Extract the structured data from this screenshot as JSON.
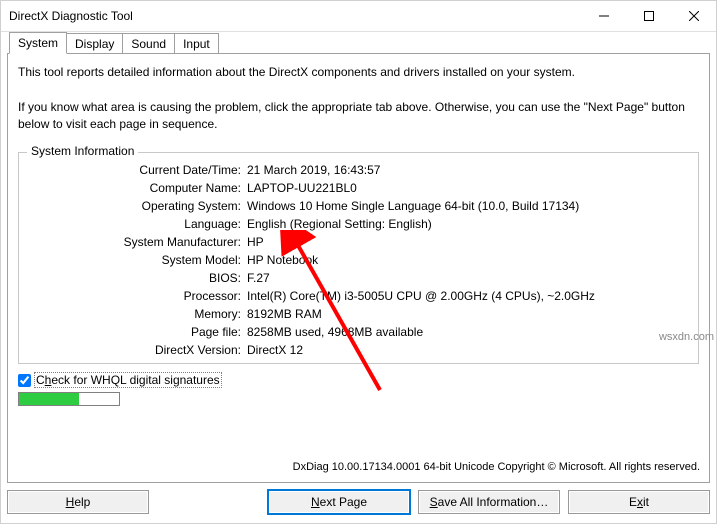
{
  "title": "DirectX Diagnostic Tool",
  "tabs": {
    "system": "System",
    "display": "Display",
    "sound": "Sound",
    "input": "Input"
  },
  "intro1": "This tool reports detailed information about the DirectX components and drivers installed on your system.",
  "intro2": "If you know what area is causing the problem, click the appropriate tab above.  Otherwise, you can use the \"Next Page\" button below to visit each page in sequence.",
  "sysinfo_legend": "System Information",
  "sysinfo": {
    "date_lbl": "Current Date/Time:",
    "date": "21 March 2019, 16:43:57",
    "name_lbl": "Computer Name:",
    "name": "LAPTOP-UU221BL0",
    "os_lbl": "Operating System:",
    "os": "Windows 10 Home Single Language 64-bit (10.0, Build 17134)",
    "lang_lbl": "Language:",
    "lang": "English (Regional Setting: English)",
    "manu_lbl": "System Manufacturer:",
    "manu": "HP",
    "model_lbl": "System Model:",
    "model": "HP Notebook",
    "bios_lbl": "BIOS:",
    "bios": "F.27",
    "cpu_lbl": "Processor:",
    "cpu": "Intel(R) Core(TM) i3-5005U CPU @ 2.00GHz (4 CPUs), ~2.0GHz",
    "mem_lbl": "Memory:",
    "mem": "8192MB RAM",
    "page_lbl": "Page file:",
    "page": "8258MB used, 4968MB available",
    "dx_lbl": "DirectX Version:",
    "dx": "DirectX 12"
  },
  "whql_pre": "C",
  "whql_u": "h",
  "whql_post": "eck for WHQL digital signatures",
  "footer_text": "DxDiag 10.00.17134.0001 64-bit Unicode  Copyright © Microsoft. All rights reserved.",
  "buttons": {
    "help_u": "H",
    "help_rest": "elp",
    "next_u": "N",
    "next_rest": "ext Page",
    "save_u": "S",
    "save_rest": "ave All Information…",
    "exit_pre": "E",
    "exit_u": "x",
    "exit_post": "it"
  },
  "watermark": "wsxdn.com"
}
